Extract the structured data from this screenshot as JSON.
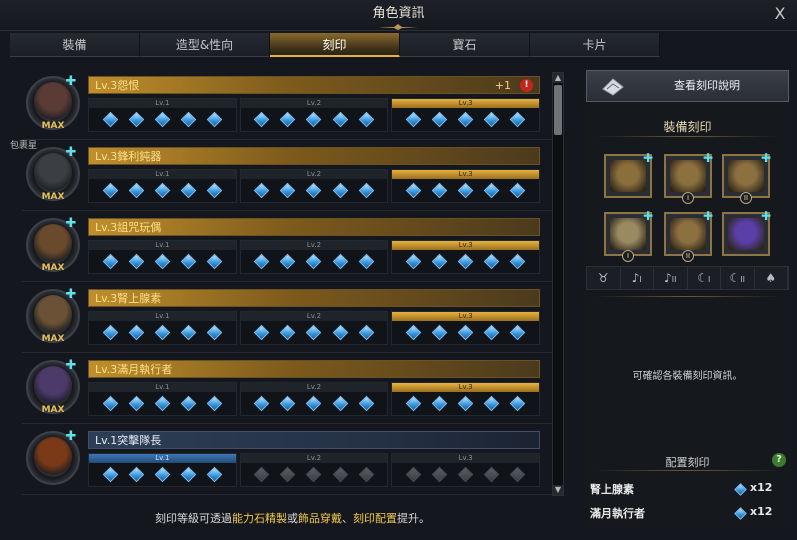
{
  "window": {
    "title": "角色資訊",
    "close": "X"
  },
  "tabs": [
    {
      "label": "裝備",
      "active": false
    },
    {
      "label": "造型&性向",
      "active": false
    },
    {
      "label": "刻印",
      "active": true
    },
    {
      "label": "寶石",
      "active": false
    },
    {
      "label": "卡片",
      "active": false
    }
  ],
  "side_tag": "包裹星",
  "engravings": [
    {
      "name": "Lv.3怨恨",
      "extra": "+1",
      "warning": "!",
      "max": "MAX",
      "levels": [
        "Lv.1",
        "Lv.2",
        "Lv.3"
      ],
      "active_level": 3,
      "filled": [
        5,
        5,
        5
      ]
    },
    {
      "name": "Lv.3鋒利鈍器",
      "max": "MAX",
      "levels": [
        "Lv.1",
        "Lv.2",
        "Lv.3"
      ],
      "active_level": 3,
      "filled": [
        5,
        5,
        5
      ]
    },
    {
      "name": "Lv.3詛咒玩偶",
      "max": "MAX",
      "levels": [
        "Lv.1",
        "Lv.2",
        "Lv.3"
      ],
      "active_level": 3,
      "filled": [
        5,
        5,
        5
      ]
    },
    {
      "name": "Lv.3腎上腺素",
      "max": "MAX",
      "levels": [
        "Lv.1",
        "Lv.2",
        "Lv.3"
      ],
      "active_level": 3,
      "filled": [
        5,
        5,
        5
      ]
    },
    {
      "name": "Lv.3滿月執行者",
      "max": "MAX",
      "levels": [
        "Lv.1",
        "Lv.2",
        "Lv.3"
      ],
      "active_level": 3,
      "filled": [
        5,
        5,
        5
      ]
    },
    {
      "name": "Lv.1突擊隊長",
      "max": "",
      "levels": [
        "Lv.1",
        "Lv.2",
        "Lv.3"
      ],
      "active_level": 1,
      "filled": [
        5,
        0,
        0
      ]
    }
  ],
  "footnote": {
    "pre": "刻印等級可透過",
    "h1": "能力石精製",
    "mid1": "或",
    "h2": "飾品穿戴",
    "mid2": "、",
    "h3": "刻印配置",
    "post": "提升。"
  },
  "right": {
    "view_button": "查看刻印說明",
    "equip_title": "裝備刻印",
    "equip_numerals": [
      "",
      "I",
      "II",
      "I",
      "II",
      ""
    ],
    "slot_labels": [
      {
        "icon": "necklace-icon",
        "glyph": "♉",
        "sub": ""
      },
      {
        "icon": "earring-icon",
        "glyph": "♪",
        "sub": "I"
      },
      {
        "icon": "earring-icon",
        "glyph": "♪",
        "sub": "II"
      },
      {
        "icon": "ring-icon",
        "glyph": "☾",
        "sub": "I"
      },
      {
        "icon": "ring-icon",
        "glyph": "☾",
        "sub": "II"
      },
      {
        "icon": "stone-icon",
        "glyph": "♠",
        "sub": ""
      }
    ],
    "info_text": "可確認各裝備刻印資訊。",
    "config_title": "配置刻印",
    "help": "?",
    "config_list": [
      {
        "name": "腎上腺素",
        "count": "x12"
      },
      {
        "name": "滿月執行者",
        "count": "x12"
      }
    ]
  },
  "colors": {
    "gold": "#e7b23f",
    "gem_blue": "#3c9be0",
    "accent_cyan": "#5fe1e6",
    "warning_red": "#c5251d"
  }
}
